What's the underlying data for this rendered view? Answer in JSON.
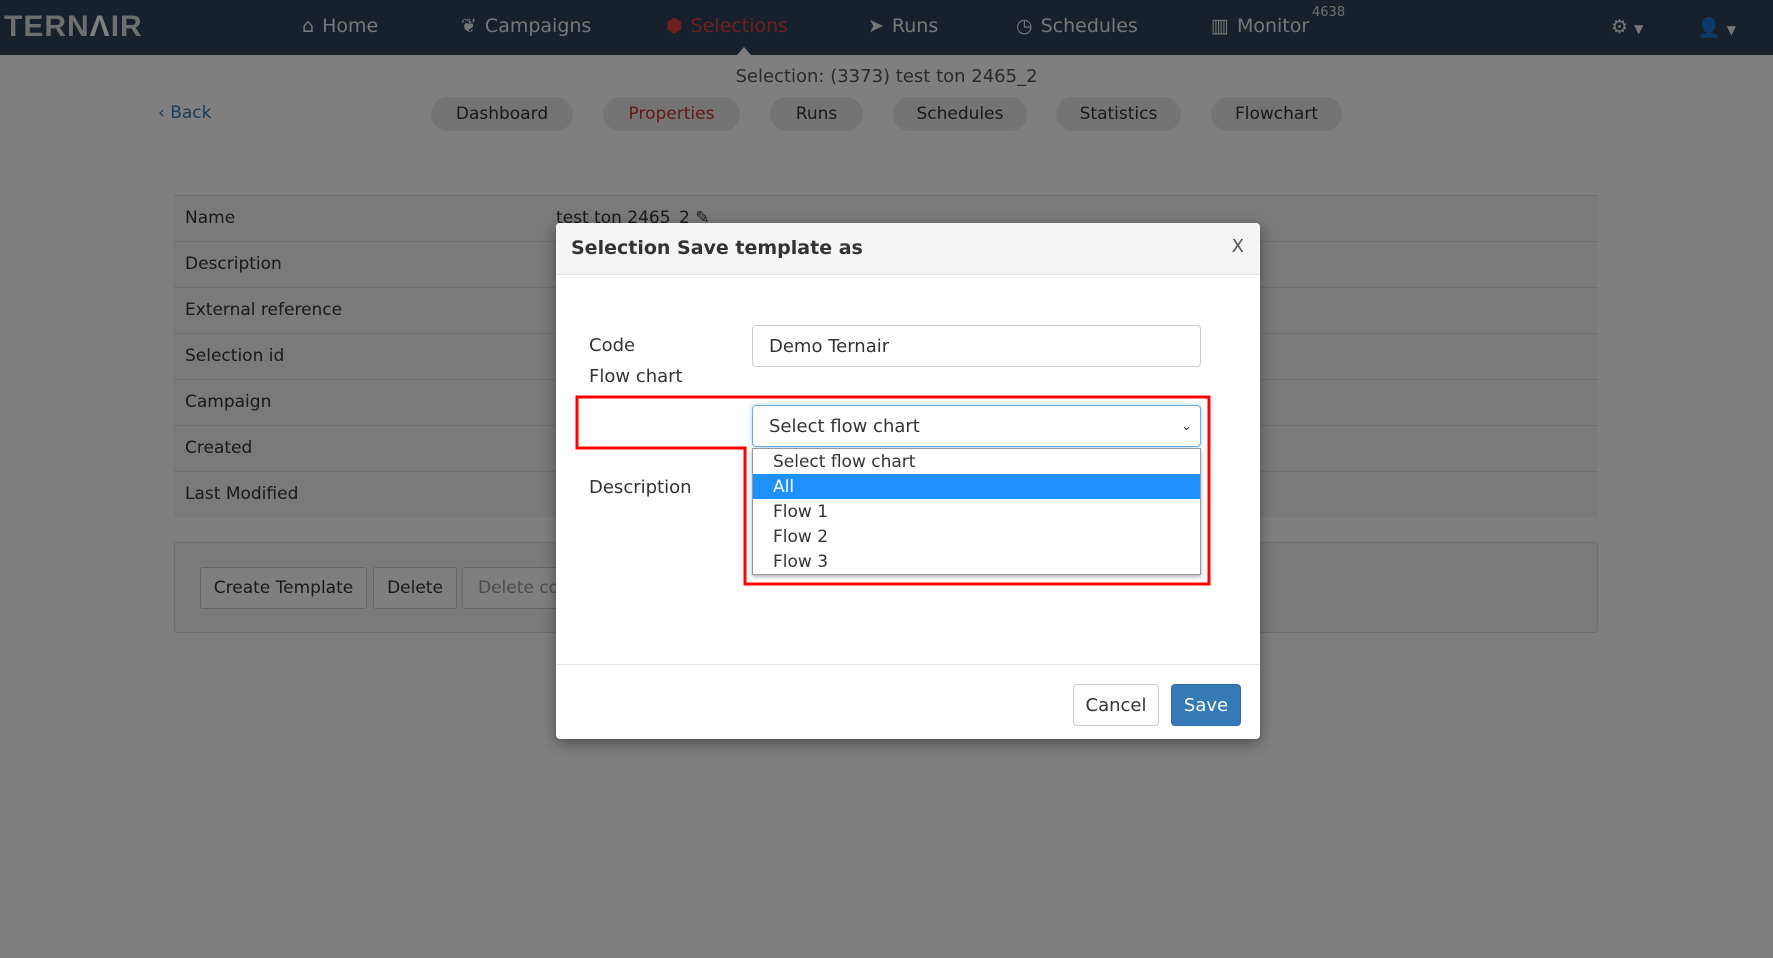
{
  "nav": {
    "logo": "TERNAIR",
    "items": [
      {
        "label": "Home",
        "icon": "home-icon"
      },
      {
        "label": "Campaigns",
        "icon": "leaf-icon"
      },
      {
        "label": "Selections",
        "icon": "cubes-icon",
        "active": true
      },
      {
        "label": "Runs",
        "icon": "paper-plane-icon"
      },
      {
        "label": "Schedules",
        "icon": "clock-icon"
      },
      {
        "label": "Monitor",
        "icon": "bar-chart-icon"
      }
    ],
    "monitor_badge": "4638"
  },
  "page": {
    "title": "Selection: (3373) test ton 2465_2",
    "back": "Back",
    "tabs": [
      "Dashboard",
      "Properties",
      "Runs",
      "Schedules",
      "Statistics",
      "Flowchart"
    ],
    "active_tab": "Properties"
  },
  "properties": {
    "rows": [
      {
        "label": "Name",
        "value": "test ton 2465_2"
      },
      {
        "label": "Description",
        "value": ""
      },
      {
        "label": "External reference",
        "value": ""
      },
      {
        "label": "Selection id",
        "value": ""
      },
      {
        "label": "Campaign",
        "value": ""
      },
      {
        "label": "Created",
        "value": ""
      },
      {
        "label": "Last Modified",
        "value": ""
      }
    ]
  },
  "actions": {
    "create_template": "Create Template",
    "delete": "Delete",
    "delete_co": "Delete co"
  },
  "modal": {
    "title": "Selection Save template as",
    "close": "X",
    "code_label": "Code",
    "code_value": "Demo Ternair",
    "flowchart_label": "Flow chart",
    "flowchart_selected": "Select flow chart",
    "flowchart_options": [
      "Select flow chart",
      "All",
      "Flow 1",
      "Flow 2",
      "Flow 3"
    ],
    "highlighted_option": "All",
    "description_label": "Description",
    "cancel": "Cancel",
    "save": "Save"
  },
  "colors": {
    "accent": "#d9413e",
    "primary": "#337ab7",
    "highlight": "#1e90ff",
    "annotation": "#ff0000"
  }
}
